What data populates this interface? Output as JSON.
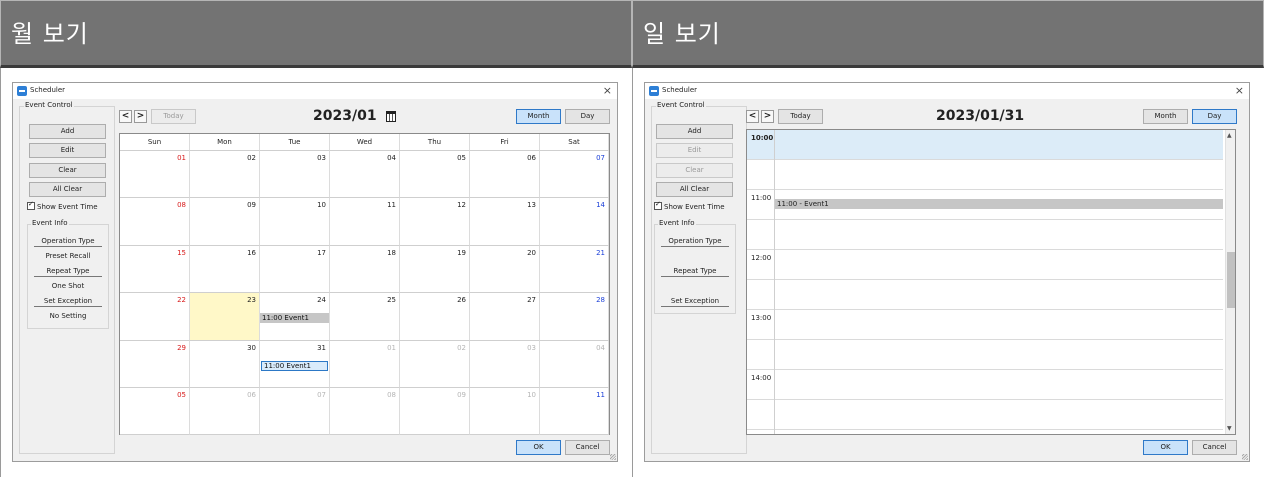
{
  "headers": {
    "left": "월 보기",
    "right": "일 보기"
  },
  "dialog": {
    "title": "Scheduler",
    "close": "×",
    "ok_label": "OK",
    "cancel_label": "Cancel"
  },
  "event_control": {
    "legend": "Event Control",
    "add": "Add",
    "edit": "Edit",
    "clear": "Clear",
    "all_clear": "All Clear",
    "show_event_time": "Show Event Time",
    "show_event_time_checked": true
  },
  "event_info": {
    "legend": "Event Info",
    "operation_type_label": "Operation Type",
    "operation_type_value": "Preset Recall",
    "repeat_type_label": "Repeat Type",
    "repeat_type_value": "One Shot",
    "set_exception_label": "Set Exception",
    "set_exception_value": "No Setting"
  },
  "navigation": {
    "prev": "<",
    "next": ">",
    "today": "Today",
    "month": "Month",
    "day": "Day"
  },
  "month_view": {
    "title": "2023/01",
    "weekdays": [
      "Sun",
      "Mon",
      "Tue",
      "Wed",
      "Thu",
      "Fri",
      "Sat"
    ],
    "weeks": [
      [
        "01",
        "02",
        "03",
        "04",
        "05",
        "06",
        "07"
      ],
      [
        "08",
        "09",
        "10",
        "11",
        "12",
        "13",
        "14"
      ],
      [
        "15",
        "16",
        "17",
        "18",
        "19",
        "20",
        "21"
      ],
      [
        "22",
        "23",
        "24",
        "25",
        "26",
        "27",
        "28"
      ],
      [
        "29",
        "30",
        "31",
        "01",
        "02",
        "03",
        "04"
      ],
      [
        "05",
        "06",
        "07",
        "08",
        "09",
        "10",
        "11"
      ]
    ],
    "today_cell": {
      "week": 3,
      "day": 1
    },
    "events": [
      {
        "week": 3,
        "day": 2,
        "label": "11:00 Event1",
        "selected": false
      },
      {
        "week": 4,
        "day": 2,
        "label": "11:00 Event1",
        "selected": true
      }
    ]
  },
  "day_view": {
    "title": "2023/01/31",
    "times": [
      "10:00",
      "",
      "11:00",
      "",
      "12:00",
      "",
      "13:00",
      "",
      "14:00",
      ""
    ],
    "event_label": "11:00 - Event1"
  },
  "colors": {
    "header_bg": "#737373",
    "sunday": "#d81b1b",
    "saturday": "#1b3fd8",
    "today_bg": "#fff8c8",
    "active_button": "#c9e2fa",
    "event_bg": "#c6c6c6",
    "selected_slot": "#dcecf8"
  },
  "icons": {
    "app": "scheduler-app-icon",
    "calendar": "calendar-icon",
    "checkbox": "checkbox-checked-icon"
  }
}
